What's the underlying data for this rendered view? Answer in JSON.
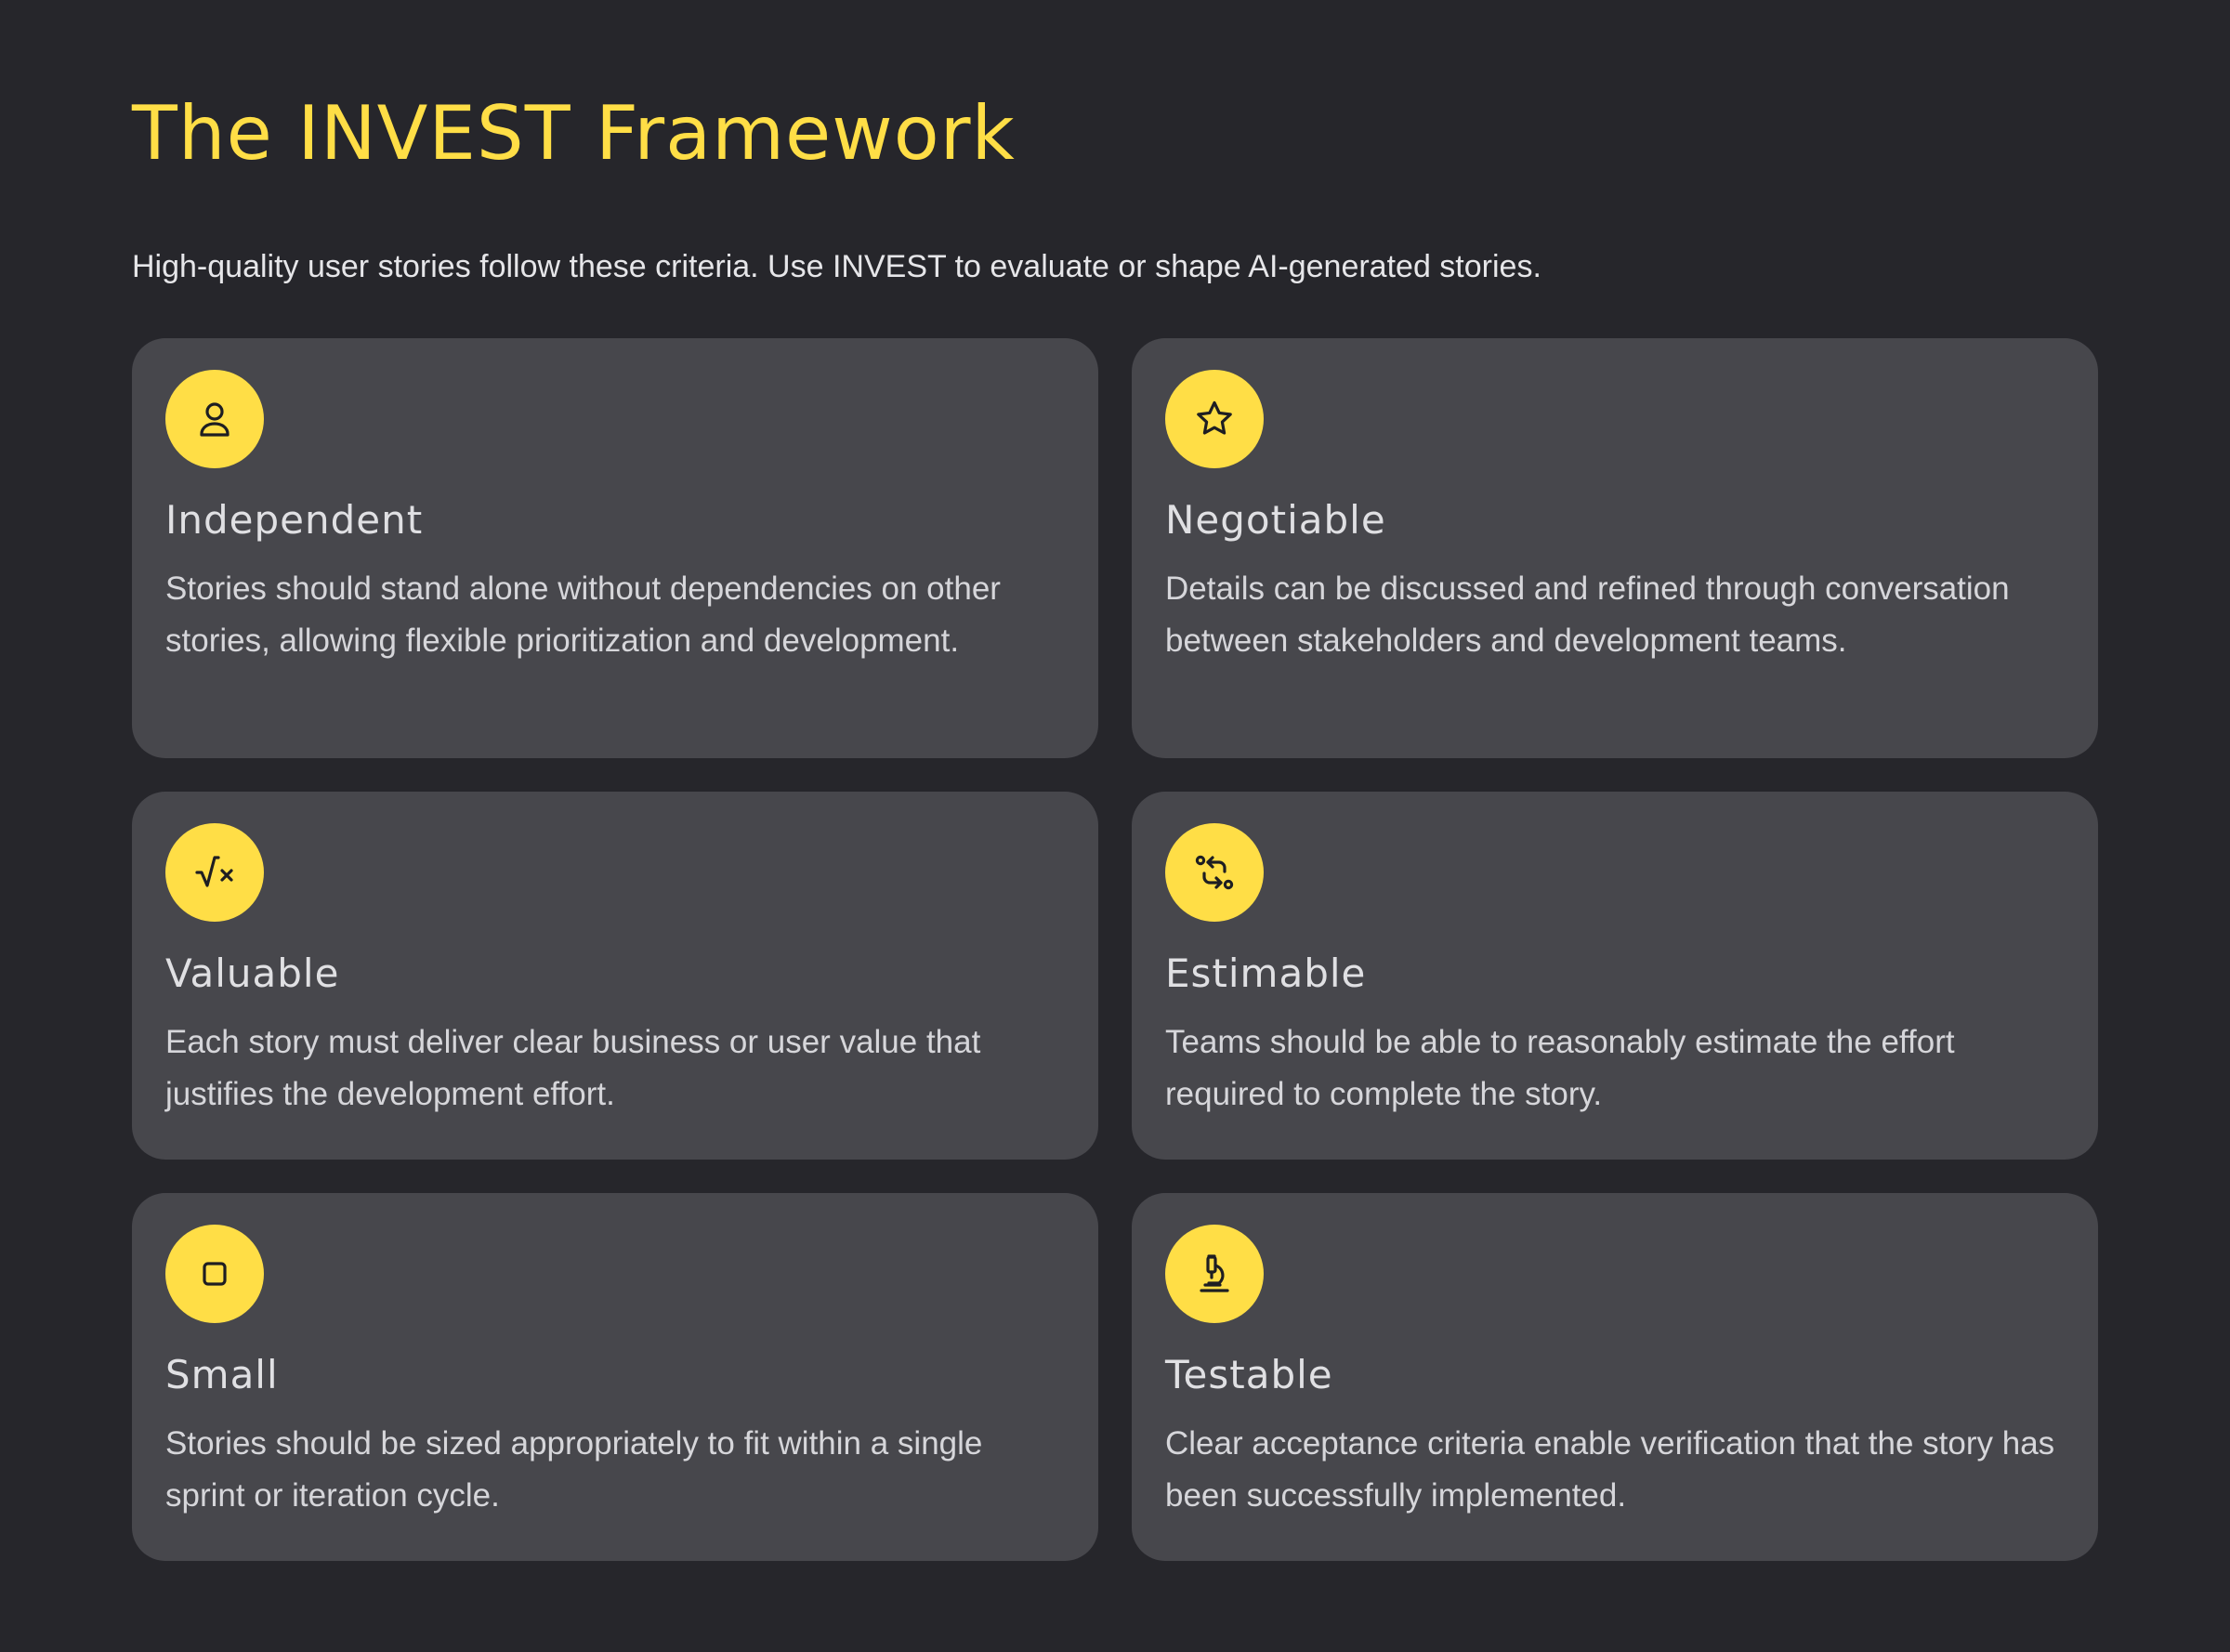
{
  "page": {
    "title": "The INVEST Framework",
    "subtitle": "High-quality user stories follow these criteria. Use INVEST to evaluate or shape AI-generated stories."
  },
  "theme": {
    "background": "#26262b",
    "card_background": "#47474c",
    "accent": "#ffde46"
  },
  "cards": [
    {
      "icon": "user-icon",
      "title": "Independent",
      "description": "Stories should stand alone without dependencies on other stories, allowing flexible prioritization and development."
    },
    {
      "icon": "star-icon",
      "title": "Negotiable",
      "description": "Details can be discussed and refined through conversation between stakeholders and development teams."
    },
    {
      "icon": "square-root-variable-icon",
      "title": "Valuable",
      "description": "Each story must deliver clear business or user value that justifies the development effort."
    },
    {
      "icon": "arrows-exchange-icon",
      "title": "Estimable",
      "description": "Teams should be able to reasonably estimate the effort required to complete the story."
    },
    {
      "icon": "square-icon",
      "title": "Small",
      "description": "Stories should be sized appropriately to fit within a single sprint or iteration cycle."
    },
    {
      "icon": "microscope-icon",
      "title": "Testable",
      "description": "Clear acceptance criteria enable verification that the story has been successfully implemented."
    }
  ]
}
